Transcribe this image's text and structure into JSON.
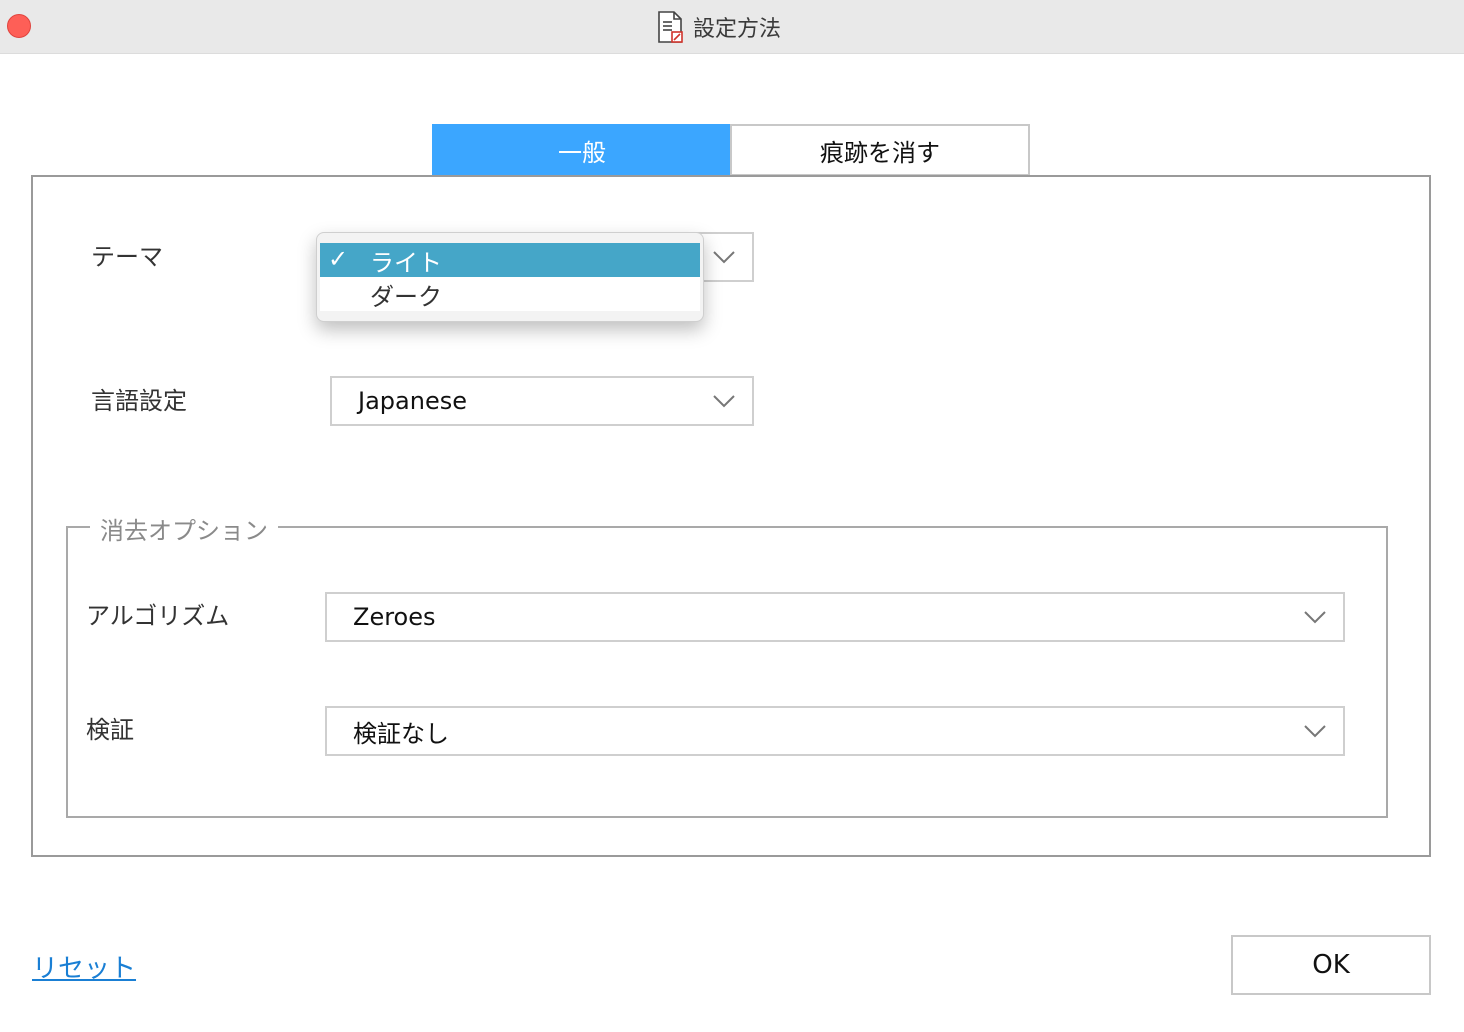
{
  "window": {
    "title": "設定方法",
    "close_color": "#fe5f57"
  },
  "tabs": [
    {
      "label": "一般",
      "active": true
    },
    {
      "label": "痕跡を消す",
      "active": false
    }
  ],
  "general": {
    "theme": {
      "label": "テーマ",
      "options": [
        {
          "label": "ライト",
          "selected": true
        },
        {
          "label": "ダーク",
          "selected": false
        }
      ]
    },
    "language": {
      "label": "言語設定",
      "value": "Japanese"
    }
  },
  "erase_options": {
    "legend": "消去オプション",
    "algorithm": {
      "label": "アルゴリズム",
      "value": "Zeroes"
    },
    "verification": {
      "label": "検証",
      "value": "検証なし"
    }
  },
  "footer": {
    "reset_label": "リセット",
    "ok_label": "OK"
  },
  "colors": {
    "accent": "#3ba6ff",
    "selected_option": "#45a6c8",
    "link": "#1a7fd4"
  }
}
